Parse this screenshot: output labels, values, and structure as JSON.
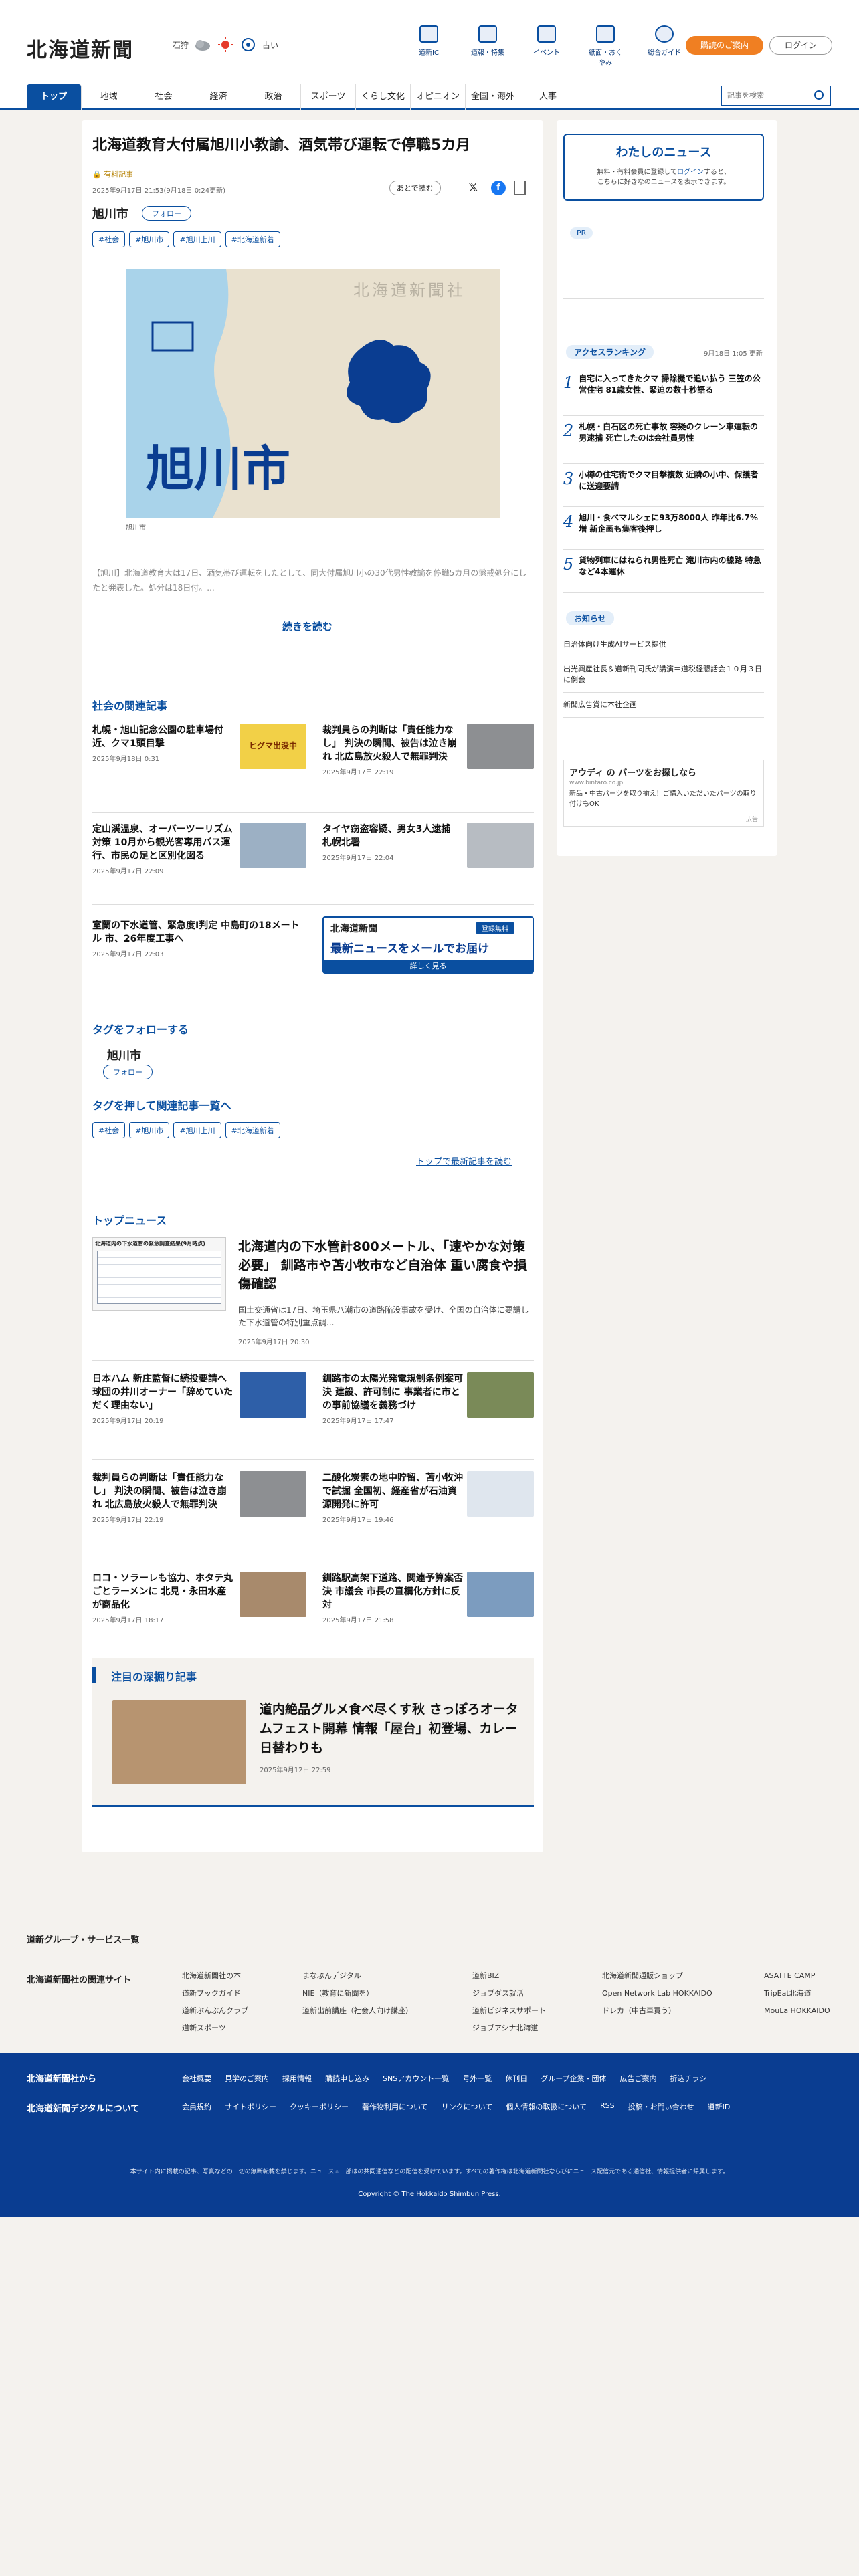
{
  "header": {
    "logo": "北海道新聞",
    "region": "石狩",
    "weather_label": "占い",
    "icons": [
      {
        "icon": "book-icon",
        "label": "道新IC"
      },
      {
        "icon": "flag-icon",
        "label": "道報・特集"
      },
      {
        "icon": "calendar-icon",
        "label": "イベント"
      },
      {
        "icon": "document-icon",
        "label": "紙面・おくやみ"
      },
      {
        "icon": "help-icon",
        "label": "総合ガイド"
      }
    ],
    "subscribe": "購読のご案内",
    "login": "ログイン"
  },
  "nav": {
    "items": [
      "トップ",
      "地域",
      "社会",
      "経済",
      "政治",
      "スポーツ",
      "くらし文化",
      "オピニオン",
      "全国・海外",
      "人事"
    ],
    "search_placeholder": "記事を検索"
  },
  "article": {
    "title": "北海道教育大付属旭川小教諭、酒気帯び運転で停職5カ月",
    "badge": "有料記事",
    "date": "2025年9月17日 21:53(9月18日 0:24更新)",
    "later": "あとで読む",
    "city": "旭川市",
    "follow": "フォロー",
    "tags": [
      "#社会",
      "#旭川市",
      "#旭川上川",
      "#北海道新着"
    ],
    "map_text": "北海道新聞社",
    "map_city": "旭川市",
    "caption": "旭川市",
    "body": "【旭川】北海道教育大は17日、酒気帯び運転をしたとして、同大付属旭川小の30代男性教諭を停職5カ月の懲戒処分にしたと発表した。処分は18日付。...",
    "read_more": "続きを読む"
  },
  "related": {
    "title": "社会の関連記事",
    "items": [
      {
        "title": "札幌・旭山記念公園の駐車場付近、クマ1頭目撃",
        "date": "2025年9月18日 0:31",
        "thumb": "ヒグマ出没中"
      },
      {
        "title": "裁判員らの判断は「責任能力なし」 判決の瞬間、被告は泣き崩れ 北広島放火殺人で無罪判決",
        "date": "2025年9月17日 22:19"
      },
      {
        "title": "定山渓温泉、オーバーツーリズム対策 10月から観光客専用バス運行、市民の足と区別化図る",
        "date": "2025年9月17日 22:09"
      },
      {
        "title": "タイヤ窃盗容疑、男女3人逮捕 札幌北署",
        "date": "2025年9月17日 22:04"
      },
      {
        "title": "室蘭の下水道管、緊急度Ⅰ判定 中島町の18メートル 市、26年度工事へ",
        "date": "2025年9月17日 22:03"
      }
    ],
    "banner": {
      "logo": "北海道新聞",
      "tag": "登録無料",
      "main": "最新ニュースをメールでお届け",
      "sub": "詳しく見る"
    }
  },
  "tagfollow": {
    "title": "タグをフォローする",
    "city": "旭川市",
    "follow": "フォロー",
    "list_title": "タグを押して関連記事一覧へ",
    "tags": [
      "#社会",
      "#旭川市",
      "#旭川上川",
      "#北海道新着"
    ],
    "latest": "トップで最新記事を読む"
  },
  "topnews": {
    "title": "トップニュース",
    "lead": {
      "title": "北海道内の下水管計800メートル、「速やかな対策必要」 釧路市や苫小牧市など自治体 重い腐食や損傷確認",
      "body": "国土交通省は17日、埼玉県八潮市の道路陥没事故を受け、全国の自治体に要請した下水道管の特別重点調...",
      "date": "2025年9月17日 20:30",
      "table_title": "北海道内の下水道管の緊急調査結果(9月時点)"
    },
    "items": [
      {
        "title": "日本ハム 新庄監督に続投要請へ 球団の井川オーナー「辞めていただく理由ない」",
        "date": "2025年9月17日 20:19"
      },
      {
        "title": "釧路市の太陽光発電規制条例案可決 建設、許可制に 事業者に市との事前協議を義務づけ",
        "date": "2025年9月17日 17:47"
      },
      {
        "title": "裁判員らの判断は「責任能力なし」 判決の瞬間、被告は泣き崩れ 北広島放火殺人で無罪判決",
        "date": "2025年9月17日 22:19"
      },
      {
        "title": "二酸化炭素の地中貯留、苫小牧沖で試掘 全国初、経産省が石油資源開発に許可",
        "date": "2025年9月17日 19:46"
      },
      {
        "title": "ロコ・ソラーレも協力、ホタテ丸ごとラーメンに 北見・永田水産が商品化",
        "date": "2025年9月17日 18:17"
      },
      {
        "title": "釧路駅高架下道路、関連予算案否決 市議会 市長の直構化方針に反対",
        "date": "2025年9月17日 21:58"
      }
    ]
  },
  "feature": {
    "title": "注目の深掘り記事",
    "item": {
      "title": "道内絶品グルメ食べ尽くす秋 さっぽろオータムフェスト開幕 情報「屋台」初登場、カレー日替わりも",
      "date": "2025年9月12日 22:59"
    }
  },
  "sidebar": {
    "mynews_title": "わたしのニュース",
    "mynews_text1": "無料・有料会員に登録して",
    "mynews_link": "ログイン",
    "mynews_text2": "すると、",
    "mynews_text3": "こちらに好きなのニュースを表示できます。",
    "pr": "PR",
    "ranking_title": "アクセスランキング",
    "ranking_date": "9月18日 1:05 更新",
    "ranking": [
      "自宅に入ってきたクマ 掃除機で追い払う 三笠の公営住宅 81歳女性、緊迫の数十秒語る",
      "札幌・白石区の死亡事故 容疑のクレーン車運転の男逮捕 死亡したのは会社員男性",
      "小樽の住宅街でクマ目撃複数 近隣の小中、保護者に送迎要請",
      "旭川・食べマルシェに93万8000人 昨年比6.7%増 新企画も集客後押し",
      "貨物列車にはねられ男性死亡 滝川市内の線路 特急など4本運休"
    ],
    "notice_title": "お知らせ",
    "notices": [
      "自治体向け生成AIサービス提供",
      "出光興産社長＆道新刊同氏が講演＝道税経懇話会１０月３日に例会",
      "新聞広告賞に本社企画"
    ],
    "ad": {
      "title": "アウディ の パーツをお探しなら",
      "url": "www.bintaro.co.jp",
      "text": "新品・中古パーツを取り揃え！ご購入いただいたパーツの取り付けもOK",
      "label": "広告"
    }
  },
  "footer": {
    "group_title": "道新グループ・サービス一覧",
    "related_title": "北海道新聞社の関連サイト",
    "columns": [
      [
        "北海道新聞社の本",
        "道新ブックガイド",
        "道新ぶんぶんクラブ",
        "道新スポーツ"
      ],
      [
        "まなぶんデジタル",
        "NIE（教育に新聞を）",
        "道新出前講座（社会人向け講座）"
      ],
      [
        "道新BIZ",
        "ジョブダス就活",
        "道新ビジネスサポート",
        "ジョブアシナ北海道"
      ],
      [
        "北海道新聞通販ショップ",
        "Open Network Lab HOKKAIDO",
        "ドレカ（中古車買う）"
      ],
      [
        "ASATTE CAMP",
        "TripEat北海道",
        "MouLa HOKKAIDO"
      ]
    ],
    "blue_left1": "北海道新聞社から",
    "blue_left2": "北海道新聞デジタルについて",
    "links1": [
      "会社概要",
      "見学のご案内",
      "採用情報",
      "購読申し込み",
      "SNSアカウント一覧",
      "号外一覧",
      "休刊日",
      "グループ企業・団体",
      "広告ご案内",
      "折込チラシ"
    ],
    "links2": [
      "会員規約",
      "サイトポリシー",
      "クッキーポリシー",
      "著作物利用について",
      "リンクについて",
      "個人情報の取扱について",
      "RSS",
      "投稿・お問い合わせ",
      "道新ID"
    ],
    "notice": "本サイト内に掲載の記事、写真などの一切の無断転載を禁じます。ニュース☆一部はの共同通信などの配信を受けています。すべての著作権は北海道新聞社ならびにニュース配信元である通信社、情報提供者に帰属します。",
    "copyright": "Copyright © The Hokkaido Shimbun Press."
  }
}
